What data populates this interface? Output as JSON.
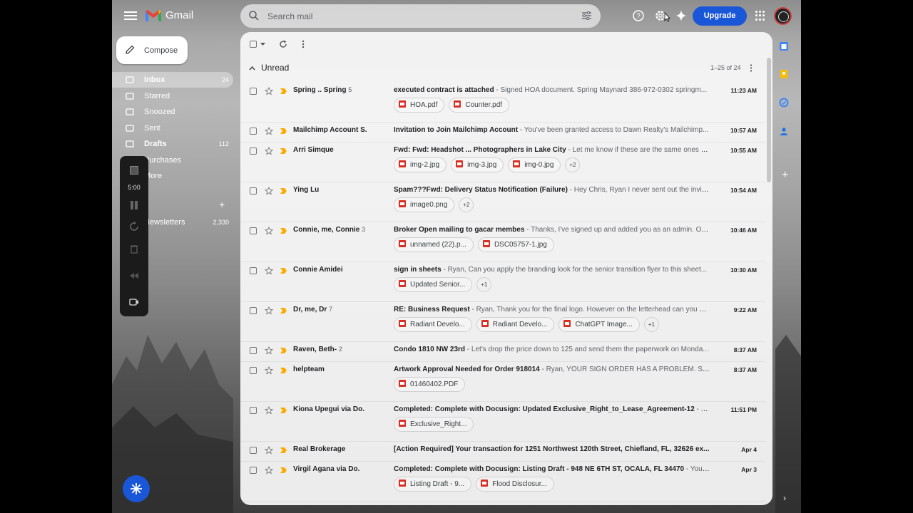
{
  "app": {
    "name": "Gmail"
  },
  "search": {
    "placeholder": "Search mail"
  },
  "header": {
    "upgrade_label": "Upgrade"
  },
  "compose_label": "Compose",
  "nav": [
    {
      "label": "Inbox",
      "count": "24",
      "icon": "inbox-icon",
      "active": true,
      "bold": true
    },
    {
      "label": "Starred",
      "count": "",
      "icon": "star-icon"
    },
    {
      "label": "Snoozed",
      "count": "",
      "icon": "clock-icon"
    },
    {
      "label": "Sent",
      "count": "",
      "icon": "send-icon"
    },
    {
      "label": "Drafts",
      "count": "112",
      "icon": "draft-icon",
      "bold": true
    },
    {
      "label": "Purchases",
      "count": "",
      "icon": "tag-icon"
    },
    {
      "label": "More",
      "count": "",
      "icon": "chevron-down-icon"
    },
    {
      "label": "s",
      "count": "",
      "icon": "label-icon"
    },
    {
      "label": "Newsletters",
      "count": "2,330",
      "icon": "label-icon"
    }
  ],
  "recorder": {
    "time": "5:00"
  },
  "section": {
    "title": "Unread",
    "pager": "1–25 of 24"
  },
  "emails": [
    {
      "sender": "Spring .. Spring",
      "count": "5",
      "subject": "executed contract is attached",
      "snippet": " - Signed HOA document. Spring Maynard 386-972-0302 springm...",
      "time": "11:23 AM",
      "attachments": [
        "HOA.pdf",
        "Counter.pdf"
      ],
      "more": ""
    },
    {
      "sender": "Mailchimp Account S.",
      "count": "",
      "subject": "Invitation to Join Mailchimp Account",
      "snippet": " - You've been granted access to Dawn Realty's Mailchimp...",
      "time": "10:57 AM",
      "attachments": [],
      "more": ""
    },
    {
      "sender": "Arri Simque",
      "count": "",
      "subject": "Fwd: Fwd: Headshot ... Photographers in Lake City",
      "snippet": " - Let me know if these are the same ones y...",
      "time": "10:55 AM",
      "attachments": [
        "img-2.jpg",
        "img-3.jpg",
        "img-0.jpg"
      ],
      "more": "+2"
    },
    {
      "sender": "Ying Lu",
      "count": "",
      "subject": "Spam???Fwd: Delivery Status Notification (Failure)",
      "snippet": " - Hey Chris, Ryan I never sent out the invita...",
      "time": "10:54 AM",
      "attachments": [
        "image0.png"
      ],
      "more": "+2"
    },
    {
      "sender": "Connie, me, Connie",
      "count": "3",
      "subject": "Broker Open mailing to gacar membes",
      "snippet": " - Thanks, I've signed up and added you as an admin. On...",
      "time": "10:46 AM",
      "attachments": [
        "unnamed (22).p...",
        "DSC05757-1.jpg"
      ],
      "more": ""
    },
    {
      "sender": "Connie Amidei",
      "count": "",
      "subject": "sign in sheets",
      "snippet": " - Ryan, Can you apply the branding look for the senior transition flyer to this sheet...",
      "time": "10:30 AM",
      "attachments": [
        "Updated Senior..."
      ],
      "more": "+1"
    },
    {
      "sender": "Dr, me, Dr",
      "count": "7",
      "subject": "RE: Business Request",
      "snippet": " - Ryan, Thank you for the final logo. However on the letterhead can you pl...",
      "time": "9:22 AM",
      "attachments": [
        "Radiant Develo...",
        "Radiant Develo...",
        "ChatGPT Image..."
      ],
      "more": "+1"
    },
    {
      "sender": "Raven, Beth-",
      "count": "2",
      "subject": "Condo 1810 NW 23rd",
      "snippet": " - Let's drop the price down to 125 and send them the paperwork on Monda...",
      "time": "8:37 AM",
      "attachments": [],
      "more": ""
    },
    {
      "sender": "helpteam",
      "count": "",
      "subject": "Artwork Approval Needed for Order 918014",
      "snippet": " - Ryan, YOUR SIGN ORDER HAS A PROBLEM. Speci...",
      "time": "8:37 AM",
      "attachments": [
        "01460402.PDF"
      ],
      "more": ""
    },
    {
      "sender": "Kiona Upegui via Do.",
      "count": "",
      "subject": "Completed: Complete with Docusign: Updated Exclusive_Right_to_Lease_Agreement-12",
      "snippet": " - Y...",
      "time": "11:51 PM",
      "attachments": [
        "Exclusive_Right..."
      ],
      "more": ""
    },
    {
      "sender": "Real Brokerage",
      "count": "",
      "subject": "[Action Required] Your transaction for 1251 Northwest 120th Street, Chiefland, FL, 32626 ex...",
      "snippet": "",
      "time": "Apr 4",
      "attachments": [],
      "more": ""
    },
    {
      "sender": "Virgil Agana via Do.",
      "count": "",
      "subject": "Completed: Complete with Docusign: Listing Draft - 948 NE 6TH ST, OCALA, FL 34470",
      "snippet": " - Your...",
      "time": "Apr 3",
      "attachments": [
        "Listing Draft - 9...",
        "Flood Disclosur..."
      ],
      "more": ""
    }
  ],
  "colors": {
    "accent": "#1a56d8",
    "attachment_icon": "#d93025",
    "important": "#f9ab00"
  }
}
